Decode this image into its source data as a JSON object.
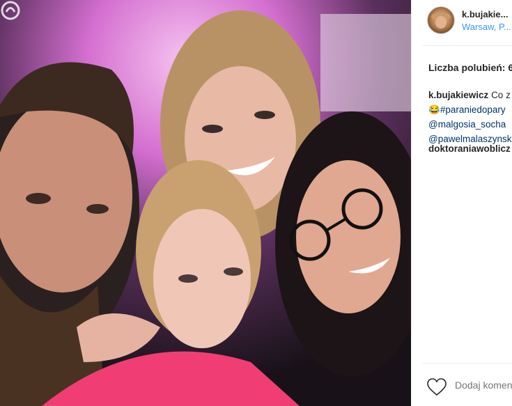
{
  "post": {
    "username": "k.bujakie...",
    "location": "Warsaw, P...",
    "likes_text": "Liczba polubień: 6",
    "caption": {
      "user": "k.bujakiewicz",
      "line1_text": "Co z",
      "line2_tag": "#paraniedopary",
      "line3_tag": "@malgosia_socha",
      "line4_tag": "@pawelmalaszynsk"
    },
    "comment_user": "doktoraniawoblicz",
    "comment_placeholder": "Dodaj komen"
  },
  "icons": {
    "heart": "heart-outline-icon",
    "emoji": "grinning-face-emoji",
    "watermark": "site-logo-watermark"
  },
  "colors": {
    "link": "#3897f0",
    "hashtag": "#003569",
    "text": "#262626"
  }
}
